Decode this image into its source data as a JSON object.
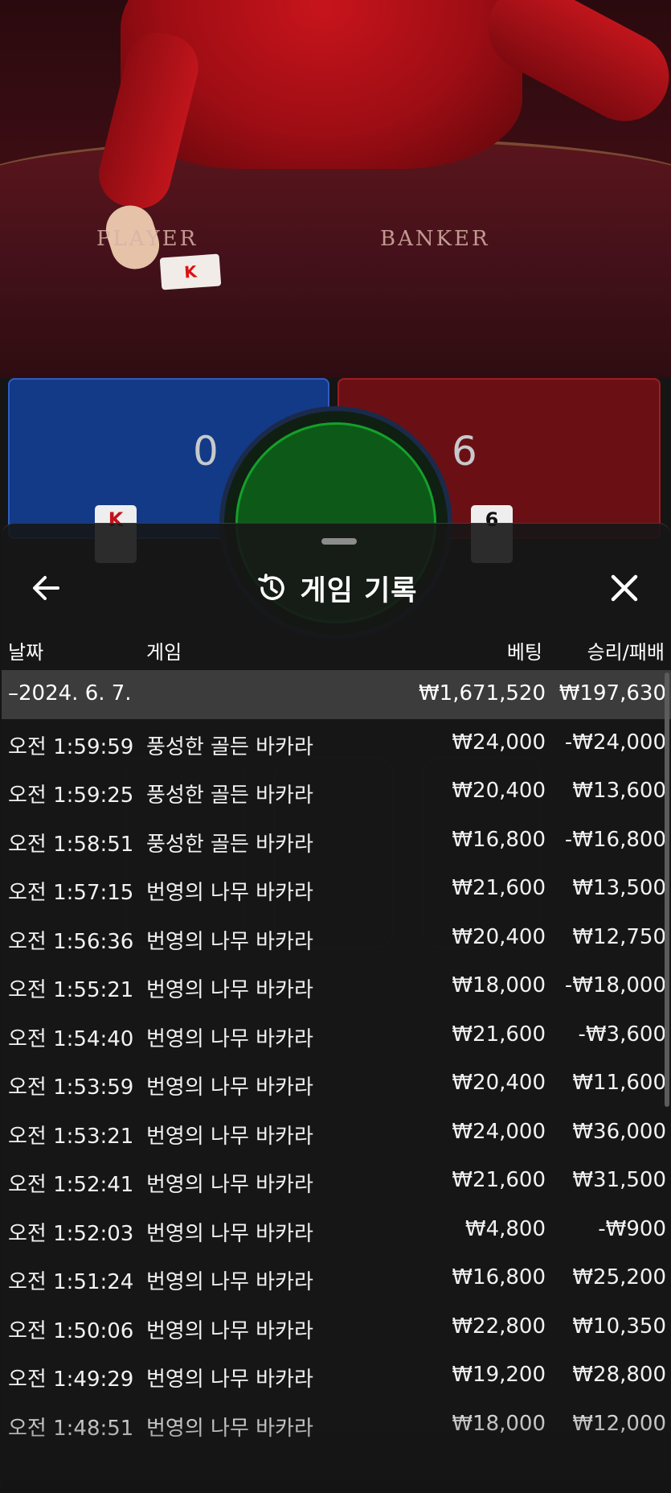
{
  "game_view": {
    "table_labels": {
      "player": "PLAYER",
      "banker": "BANKER"
    },
    "table_card": "K",
    "scores": {
      "player": "0",
      "banker": "6"
    },
    "player_card": "K",
    "banker_card": "6",
    "colors": {
      "player": "#123a86",
      "banker": "#6a1014",
      "tie": "#0d5a18",
      "dealer_dress": "#c8141c"
    }
  },
  "history_sheet": {
    "title": "게임 기록",
    "icons": {
      "back": "arrow-left-icon",
      "history": "history-clock-icon",
      "close": "close-x-icon"
    },
    "columns": {
      "date": "날짜",
      "game": "게임",
      "bet": "베팅",
      "result": "승리/패배"
    },
    "date_group": {
      "date": "–2024. 6. 7.",
      "total_bet": "₩1,671,520",
      "total_result": "₩197,630"
    },
    "rows": [
      {
        "time": "오전 1:59:59",
        "game": "풍성한 골든 바카라",
        "bet": "₩24,000",
        "result": "-₩24,000"
      },
      {
        "time": "오전 1:59:25",
        "game": "풍성한 골든 바카라",
        "bet": "₩20,400",
        "result": "₩13,600"
      },
      {
        "time": "오전 1:58:51",
        "game": "풍성한 골든 바카라",
        "bet": "₩16,800",
        "result": "-₩16,800"
      },
      {
        "time": "오전 1:57:15",
        "game": "번영의 나무 바카라",
        "bet": "₩21,600",
        "result": "₩13,500"
      },
      {
        "time": "오전 1:56:36",
        "game": "번영의 나무 바카라",
        "bet": "₩20,400",
        "result": "₩12,750"
      },
      {
        "time": "오전 1:55:21",
        "game": "번영의 나무 바카라",
        "bet": "₩18,000",
        "result": "-₩18,000"
      },
      {
        "time": "오전 1:54:40",
        "game": "번영의 나무 바카라",
        "bet": "₩21,600",
        "result": "-₩3,600"
      },
      {
        "time": "오전 1:53:59",
        "game": "번영의 나무 바카라",
        "bet": "₩20,400",
        "result": "₩11,600"
      },
      {
        "time": "오전 1:53:21",
        "game": "번영의 나무 바카라",
        "bet": "₩24,000",
        "result": "₩36,000"
      },
      {
        "time": "오전 1:52:41",
        "game": "번영의 나무 바카라",
        "bet": "₩21,600",
        "result": "₩31,500"
      },
      {
        "time": "오전 1:52:03",
        "game": "번영의 나무 바카라",
        "bet": "₩4,800",
        "result": "-₩900"
      },
      {
        "time": "오전 1:51:24",
        "game": "번영의 나무 바카라",
        "bet": "₩16,800",
        "result": "₩25,200"
      },
      {
        "time": "오전 1:50:06",
        "game": "번영의 나무 바카라",
        "bet": "₩22,800",
        "result": "₩10,350"
      },
      {
        "time": "오전 1:49:29",
        "game": "번영의 나무 바카라",
        "bet": "₩19,200",
        "result": "₩28,800"
      },
      {
        "time": "오전 1:48:51",
        "game": "번영의 나무 바카라",
        "bet": "₩18,000",
        "result": "₩12,000"
      }
    ]
  }
}
